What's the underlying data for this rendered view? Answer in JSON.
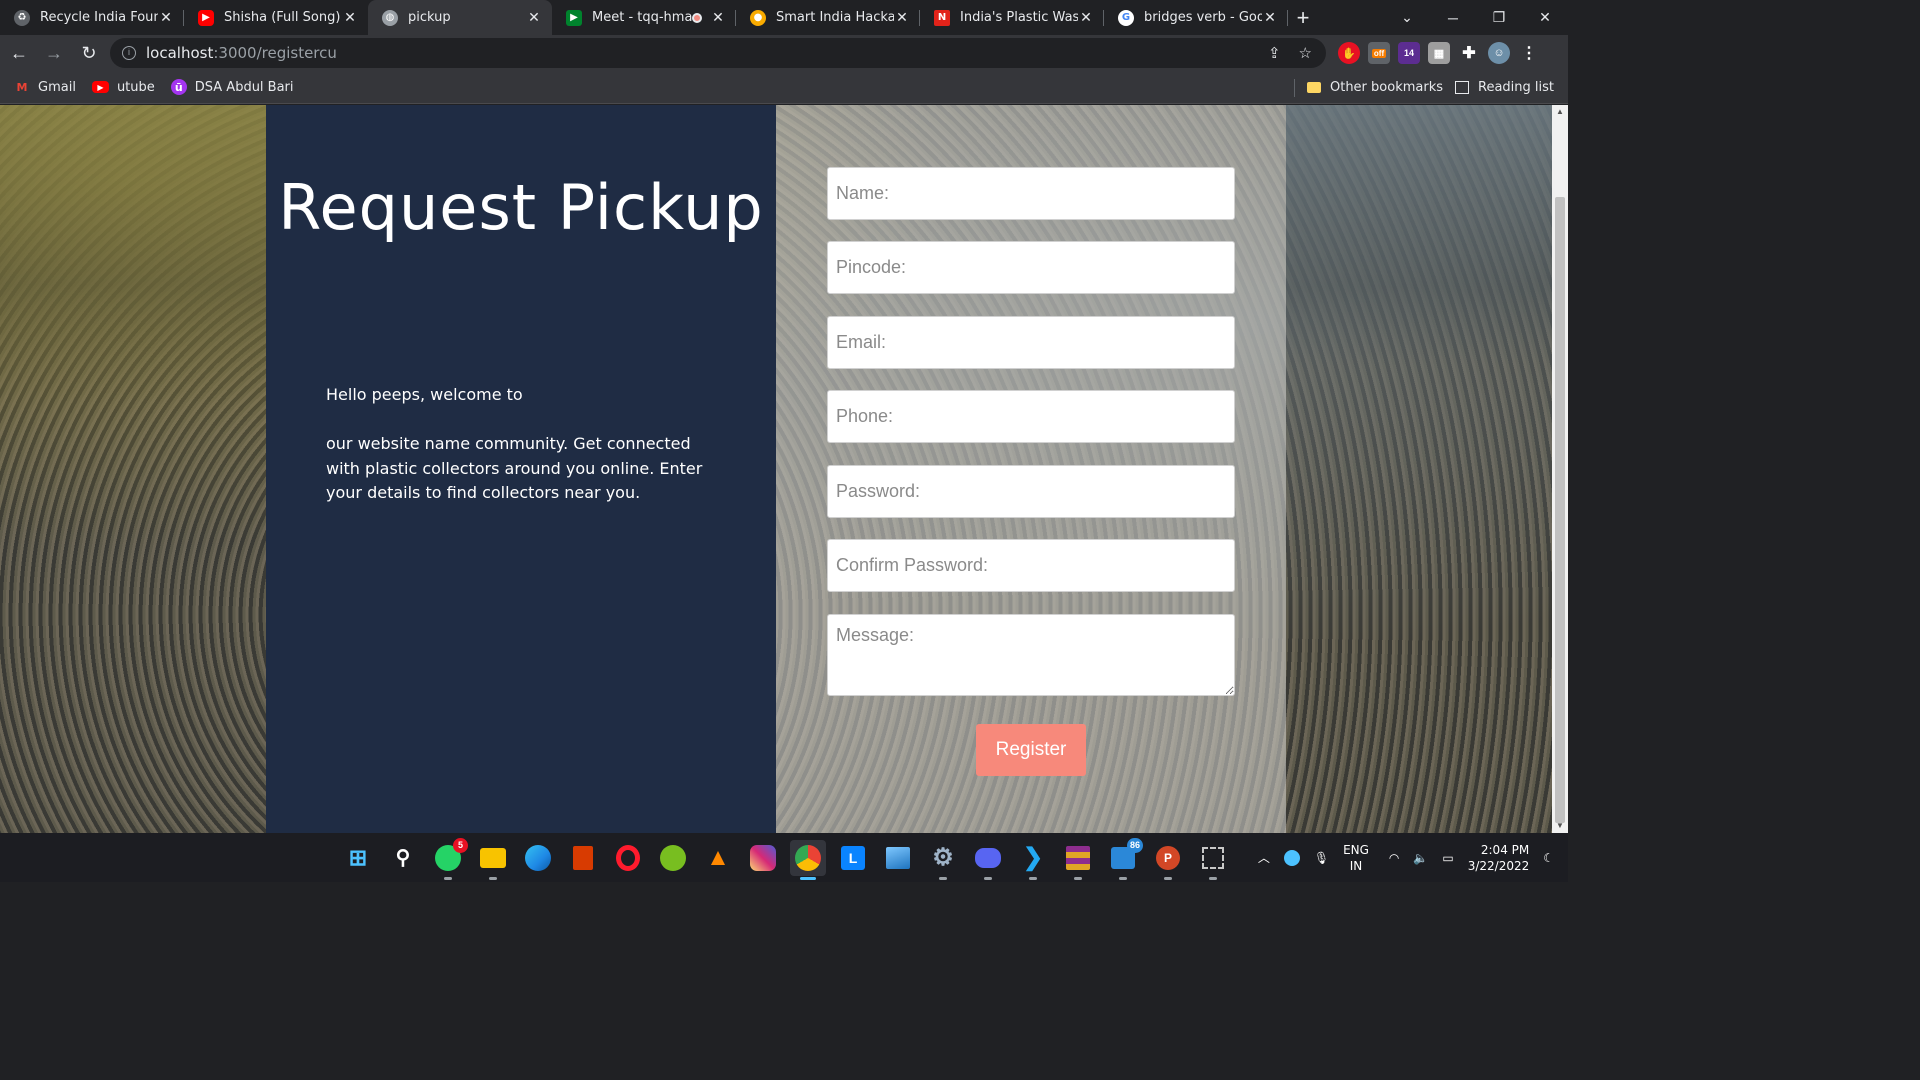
{
  "browser": {
    "tabs": [
      {
        "title": "Recycle India Foundat",
        "favicon_color": "#5f6368",
        "recording": false,
        "active": false
      },
      {
        "title": "Shisha (Full Song) | Ar",
        "favicon_color": "#ff0000",
        "recording": false,
        "active": false
      },
      {
        "title": "pickup",
        "favicon_color": "#9aa0a6",
        "recording": false,
        "active": true
      },
      {
        "title": "Meet - tqq-hmac",
        "favicon_color": "#00832d",
        "recording": true,
        "active": false
      },
      {
        "title": "Smart India Hackatho",
        "favicon_color": "#f9ab00",
        "recording": false,
        "active": false
      },
      {
        "title": "India's Plastic Waste C",
        "favicon_color": "#e2231a",
        "recording": false,
        "active": false
      },
      {
        "title": "bridges verb - Google",
        "favicon_color": "#4285f4",
        "recording": false,
        "active": false
      }
    ],
    "address": {
      "host": "localhost",
      "path": ":3000/registercu"
    },
    "bookmarks": [
      {
        "label": "Gmail",
        "icon": "gmail-icon",
        "color": "#ea4335"
      },
      {
        "label": "utube",
        "icon": "youtube-icon",
        "color": "#ff0000"
      },
      {
        "label": "DSA Abdul Bari",
        "icon": "udemy-icon",
        "color": "#a435f0"
      }
    ],
    "other_bookmarks": "Other bookmarks",
    "reading_list": "Reading list",
    "extensions": [
      {
        "name": "adblock-extension-icon",
        "label": "",
        "color": "#e81123"
      },
      {
        "name": "honey-extension-icon",
        "label": "off",
        "color": "#f57c00"
      },
      {
        "name": "extension-badge-icon",
        "label": "14",
        "color": "#5c2d91"
      },
      {
        "name": "notes-extension-icon",
        "label": "",
        "color": "#9e9e9e"
      },
      {
        "name": "puzzle-extensions-icon",
        "label": "",
        "color": "#35363a"
      },
      {
        "name": "profile-avatar-icon",
        "label": "",
        "color": "#6d8fa8"
      }
    ]
  },
  "page": {
    "title": "Request Pickup",
    "intro_line1": "Hello peeps, welcome to",
    "intro_line2": "our website name community. Get connected with plastic collectors around you online. Enter your details to find collectors near you.",
    "form": {
      "name_placeholder": "Name:",
      "pincode_placeholder": "Pincode:",
      "email_placeholder": "Email:",
      "phone_placeholder": "Phone:",
      "password_placeholder": "Password:",
      "confirm_password_placeholder": "Confirm Password:",
      "message_placeholder": "Message:",
      "register_label": "Register"
    },
    "colors": {
      "left_panel": "#1f2c44",
      "button": "#f7897b"
    }
  },
  "taskbar": {
    "apps": [
      {
        "name": "start-icon",
        "color": "#0078d4",
        "badge": ""
      },
      {
        "name": "search-icon",
        "color": "#1c1d22",
        "badge": ""
      },
      {
        "name": "whatsapp-icon",
        "color": "#25d366",
        "badge": "5"
      },
      {
        "name": "file-explorer-icon",
        "color": "#f8c300",
        "badge": ""
      },
      {
        "name": "edge-icon",
        "color": "#1e88e5",
        "badge": ""
      },
      {
        "name": "office-icon",
        "color": "#d83b01",
        "badge": ""
      },
      {
        "name": "opera-icon",
        "color": "#ff1b2d",
        "badge": ""
      },
      {
        "name": "utorrent-icon",
        "color": "#78be20",
        "badge": ""
      },
      {
        "name": "vlc-icon",
        "color": "#ff8800",
        "badge": ""
      },
      {
        "name": "instagram-icon",
        "color": "#d62976",
        "badge": ""
      },
      {
        "name": "chrome-icon",
        "color": "#4285f4",
        "badge": ""
      },
      {
        "name": "lens-icon",
        "color": "#0a84ff",
        "badge": ""
      },
      {
        "name": "photos-icon",
        "color": "#1e73be",
        "badge": ""
      },
      {
        "name": "settings-icon",
        "color": "#6b7d8f",
        "badge": ""
      },
      {
        "name": "discord-icon",
        "color": "#5865f2",
        "badge": ""
      },
      {
        "name": "vscode-icon",
        "color": "#007acc",
        "badge": ""
      },
      {
        "name": "winrar-icon",
        "color": "#8e2d8e",
        "badge": ""
      },
      {
        "name": "teams-icon",
        "color": "#2b88d8",
        "badge": "86"
      },
      {
        "name": "powerpoint-icon",
        "color": "#d24726",
        "badge": ""
      },
      {
        "name": "snipping-tool-icon",
        "color": "#c8c8c8",
        "badge": ""
      }
    ],
    "lang_top": "ENG",
    "lang_bottom": "IN",
    "time": "2:04 PM",
    "date": "3/22/2022"
  }
}
